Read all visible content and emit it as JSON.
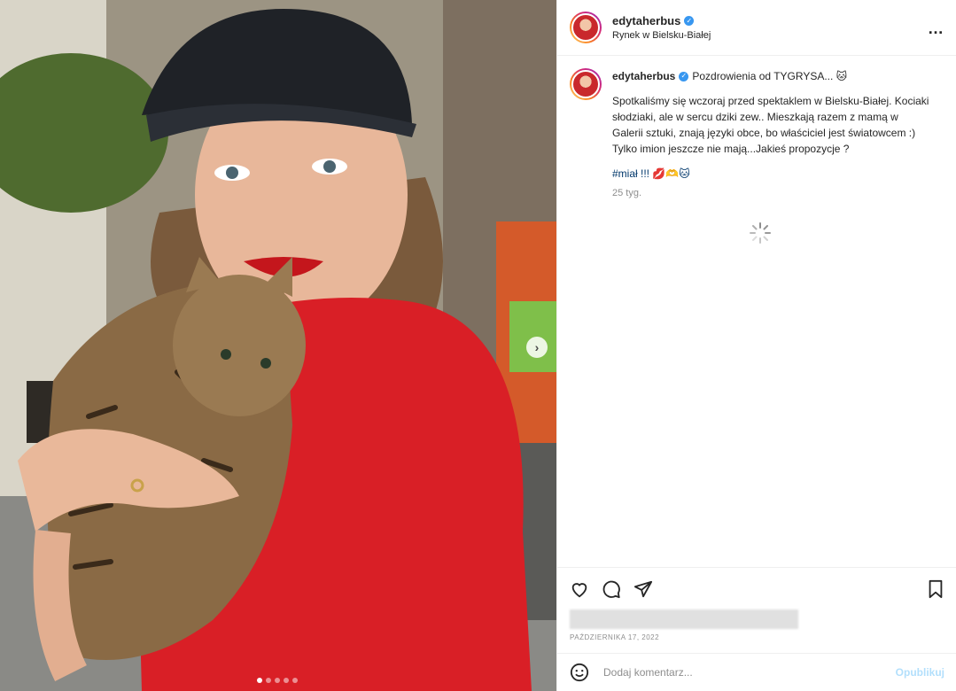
{
  "post": {
    "username": "edytaherbus",
    "location": "Rynek w Bielsku-Białej",
    "more_icon": "…"
  },
  "caption": {
    "username": "edytaherbus",
    "title": "Pozdrowienia od TYGRYSA... 🐱",
    "text": "Spotkaliśmy się wczoraj przed spektaklem w Bielsku-Białej. Kociaki słodziaki, ale w sercu dziki zew.. Mieszkają razem z mamą w Galerii sztuki, znają języki obce, bo właściciel jest światowcem :)\nTylko imion jeszcze nie mają...Jakieś propozycje ?",
    "hashtag": "#miał !!! 💋🫶🐱",
    "age": "25 tyg."
  },
  "footer": {
    "date": "PAŹDZIERNIKA 17, 2022",
    "comment_placeholder": "Dodaj komentarz...",
    "publish_label": "Opublikuj"
  },
  "carousel": {
    "next_icon": "chevron-right-icon",
    "slide_count": 5,
    "active_slide": 1
  }
}
